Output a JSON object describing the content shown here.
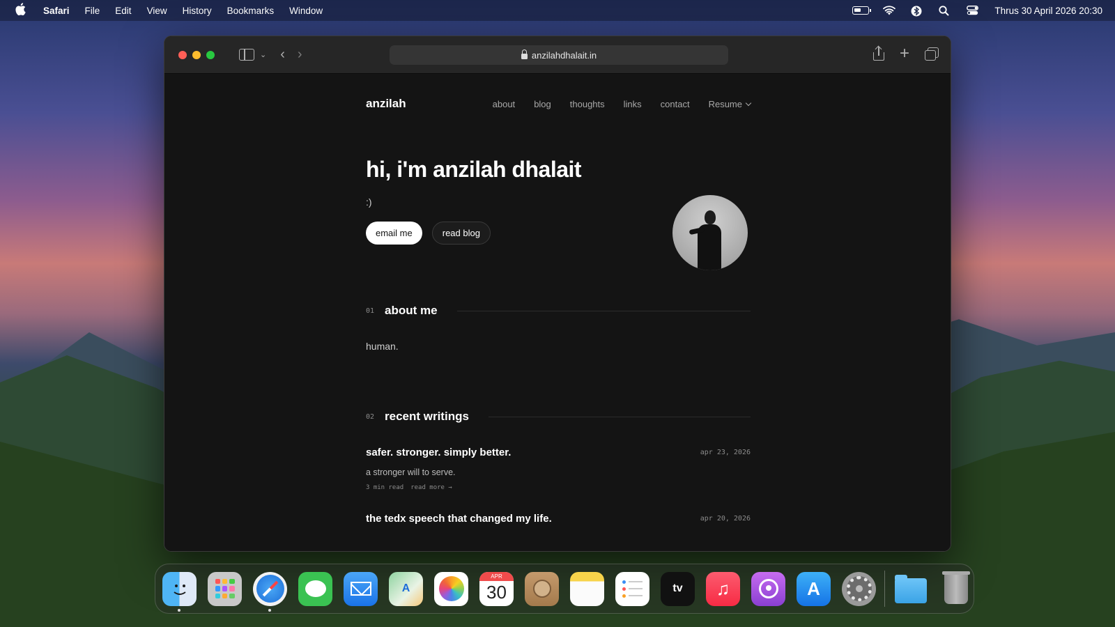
{
  "menubar": {
    "app_name": "Safari",
    "menus": [
      "File",
      "Edit",
      "View",
      "History",
      "Bookmarks",
      "Window"
    ],
    "clock": "Thrus 30 April 2026  20:30"
  },
  "browser": {
    "url": "anzilahdhalait.in"
  },
  "site": {
    "brand": "anzilah",
    "nav": [
      "about",
      "blog",
      "thoughts",
      "links",
      "contact"
    ],
    "resume_label": "Resume",
    "hero_title": "hi, i'm anzilah dhalait",
    "hero_subtitle": ":)",
    "email_button": "email me",
    "blog_button": "read blog",
    "about": {
      "number": "01",
      "title": "about me",
      "text": "human."
    },
    "writings": {
      "number": "02",
      "title": "recent writings",
      "posts": [
        {
          "title": "safer. stronger. simply better.",
          "date": "apr 23, 2026",
          "excerpt": "a stronger will to serve.",
          "read_time": "3 min read",
          "read_more": "read more →"
        },
        {
          "title": "the tedx speech that changed my life.",
          "date": "apr 20, 2026"
        }
      ]
    }
  },
  "dock": {
    "calendar_month": "APR",
    "calendar_day": "30",
    "appletv_label": "tv",
    "music_glyph": "♫",
    "appstore_glyph": "A",
    "maps_glyph": "A"
  }
}
